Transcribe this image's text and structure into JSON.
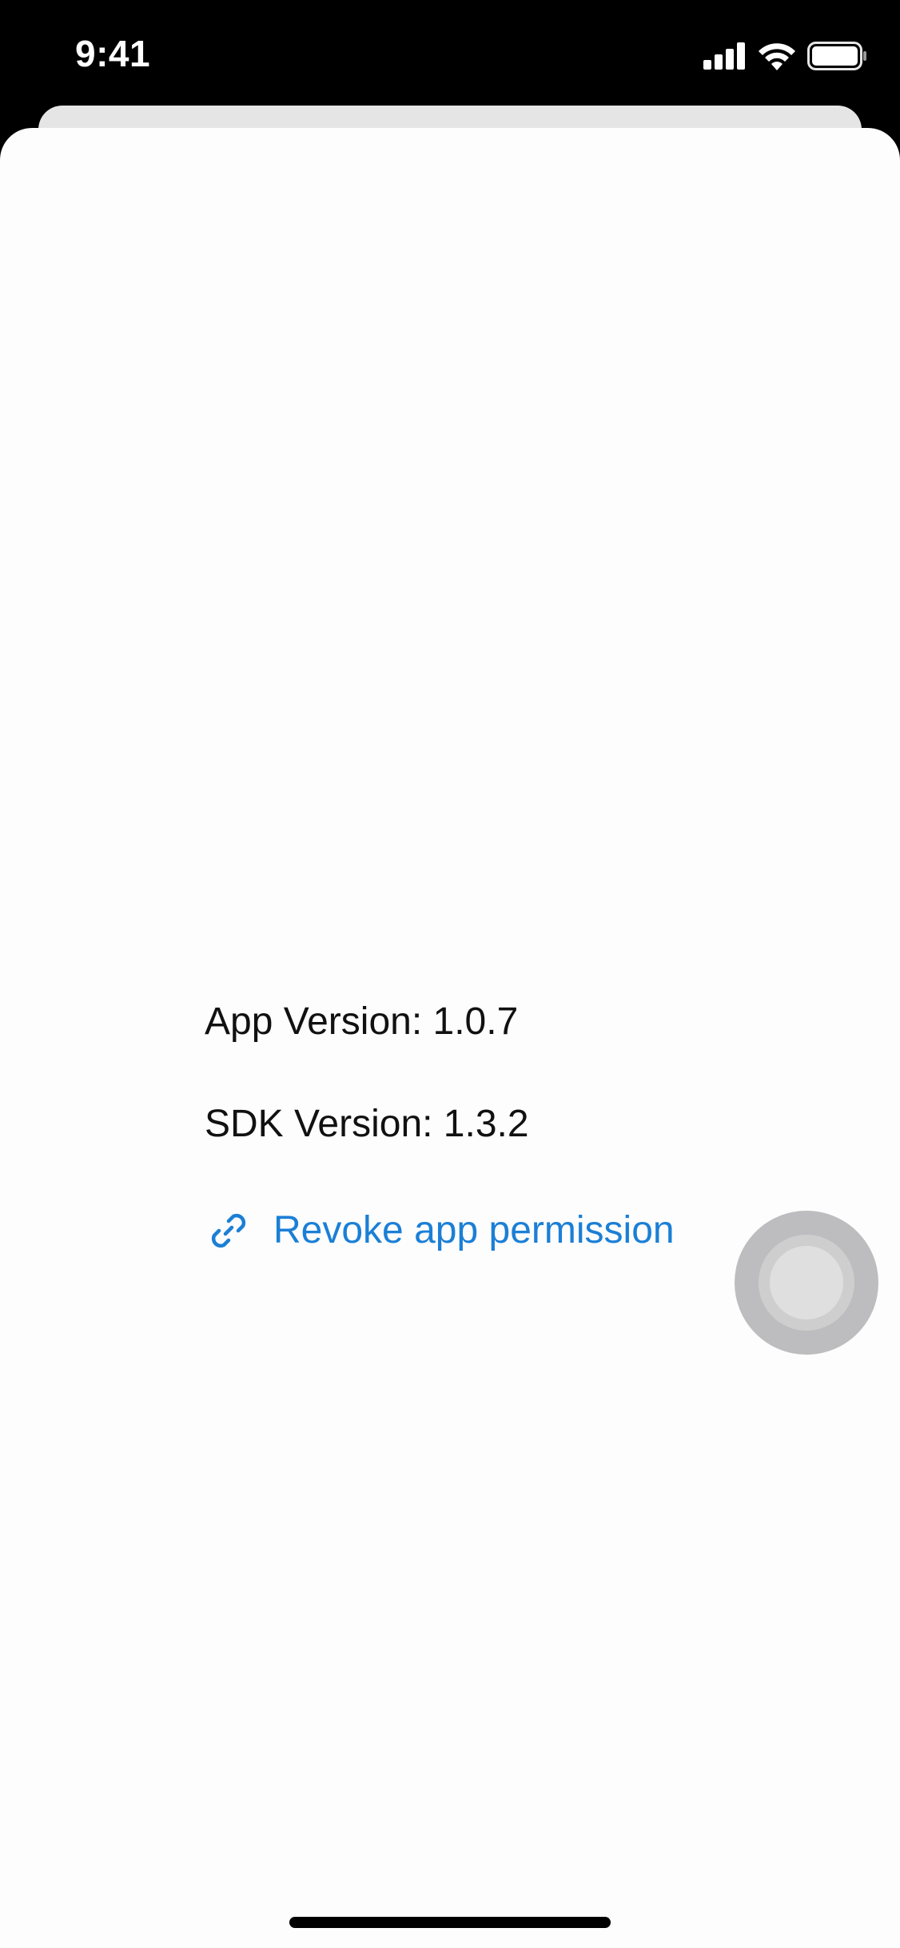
{
  "status_bar": {
    "time": "9:41",
    "icons": [
      "signal-icon",
      "wifi-icon",
      "battery-icon"
    ]
  },
  "app_info": {
    "app_version": "App Version: 1.0.7",
    "sdk_version": "SDK Version: 1.3.2"
  },
  "actions": {
    "revoke_label": "Revoke app permission",
    "revoke_icon": "link-icon"
  },
  "colors": {
    "link": "#1b7fd6",
    "text": "#111111",
    "sheet_background": "#fdfdfd"
  }
}
